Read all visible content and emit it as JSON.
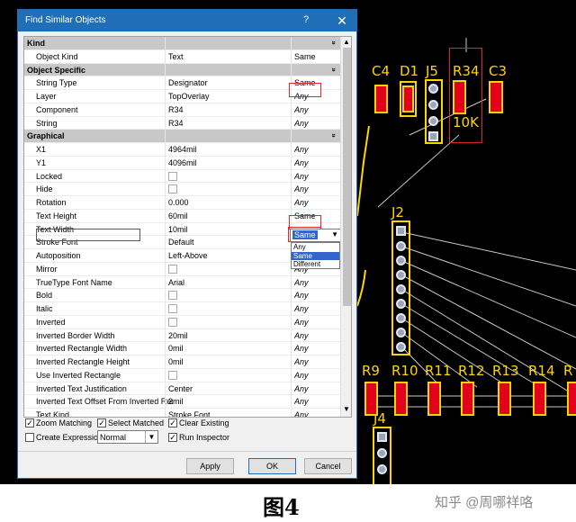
{
  "dialog": {
    "title": "Find Similar Objects",
    "help": "?",
    "close": "✕"
  },
  "grid": {
    "rows": [
      {
        "type": "category",
        "label": "Kind"
      },
      {
        "label": "Object Kind",
        "value": "Text",
        "mode": "Same"
      },
      {
        "type": "category",
        "label": "Object Specific"
      },
      {
        "label": "String Type",
        "value": "Designator",
        "mode": "Same"
      },
      {
        "label": "Layer",
        "value": "TopOverlay",
        "mode": "Any"
      },
      {
        "label": "Component",
        "value": "R34",
        "mode": "Any"
      },
      {
        "label": "String",
        "value": "R34",
        "mode": "Any"
      },
      {
        "type": "category",
        "label": "Graphical"
      },
      {
        "label": "X1",
        "value": "4964mil",
        "mode": "Any"
      },
      {
        "label": "Y1",
        "value": "4096mil",
        "mode": "Any"
      },
      {
        "label": "Locked",
        "checkbox": true,
        "mode": "Any"
      },
      {
        "label": "Hide",
        "checkbox": true,
        "mode": "Any"
      },
      {
        "label": "Rotation",
        "value": "0.000",
        "mode": "Any"
      },
      {
        "label": "Text Height",
        "value": "60mil",
        "mode": "Same"
      },
      {
        "label": "Text Width",
        "value": "10mil",
        "mode": "Same"
      },
      {
        "label": "Stroke Font",
        "value": "Default",
        "mode": "Any"
      },
      {
        "label": "Autoposition",
        "value": "Left-Above",
        "mode": "Any"
      },
      {
        "label": "Mirror",
        "checkbox": true,
        "mode": "Any"
      },
      {
        "label": "TrueType Font Name",
        "value": "Arial",
        "mode": "Any"
      },
      {
        "label": "Bold",
        "checkbox": true,
        "mode": "Any"
      },
      {
        "label": "Italic",
        "checkbox": true,
        "mode": "Any"
      },
      {
        "label": "Inverted",
        "checkbox": true,
        "mode": "Any"
      },
      {
        "label": "Inverted Border Width",
        "value": "20mil",
        "mode": "Any"
      },
      {
        "label": "Inverted Rectangle Width",
        "value": "0mil",
        "mode": "Any"
      },
      {
        "label": "Inverted Rectangle Height",
        "value": "0mil",
        "mode": "Any"
      },
      {
        "label": "Use Inverted Rectangle",
        "checkbox": true,
        "mode": "Any"
      },
      {
        "label": "Inverted Text Justification",
        "value": "Center",
        "mode": "Any"
      },
      {
        "label": "Inverted Text Offset From Inverted Rect",
        "value": "2mil",
        "mode": "Any"
      },
      {
        "label": "Text Kind",
        "value": "Stroke Font",
        "mode": "Any"
      }
    ]
  },
  "dropdown": {
    "selected": "Same",
    "options": [
      "Any",
      "Same",
      "Different"
    ]
  },
  "options": {
    "zoom_matching": "Zoom Matching",
    "select_matched": "Select Matched",
    "clear_existing": "Clear Existing",
    "create_expression": "Create Expression",
    "select_value": "Normal",
    "run_inspector": "Run Inspector",
    "checkmark": "✓"
  },
  "buttons": {
    "apply": "Apply",
    "ok": "OK",
    "cancel": "Cancel"
  },
  "pcb": {
    "labels": [
      "C4",
      "D1",
      "J5",
      "R34",
      "C3",
      "10K",
      "J2",
      "R9",
      "R10",
      "R11",
      "R12",
      "R13",
      "R14",
      "R",
      "J4"
    ]
  },
  "caption": {
    "title": "图4",
    "watermark": "知乎 @周哪祥咯"
  },
  "colors": {
    "silkscreen": "#ffd400",
    "pad": "#e3001b",
    "titlebar": "#1f6fb8",
    "highlight": "#3366cc"
  }
}
